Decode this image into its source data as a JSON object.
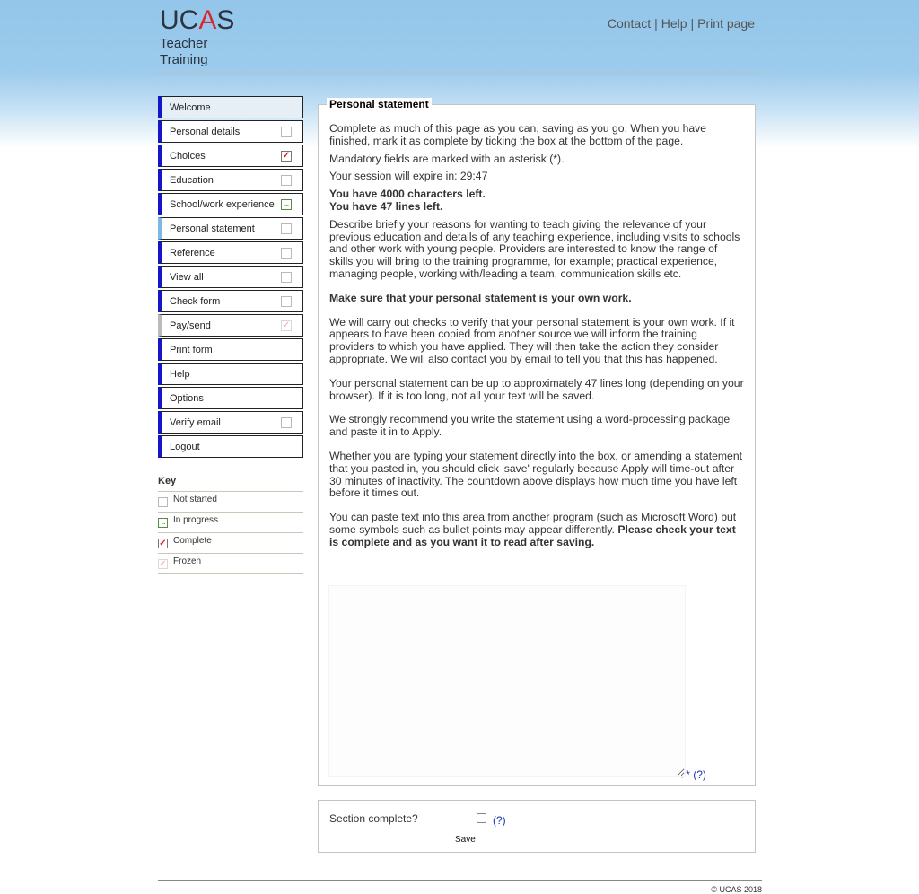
{
  "header": {
    "logo_main_left": "UC",
    "logo_main_accent": "A",
    "logo_main_right": "S",
    "logo_sub": "Teacher Training",
    "links": [
      "Contact",
      "Help",
      "Print page"
    ],
    "separator": "|"
  },
  "nav": {
    "items": [
      {
        "label": "Welcome",
        "status": "none"
      },
      {
        "label": "Personal details",
        "status": "not-started"
      },
      {
        "label": "Choices",
        "status": "complete"
      },
      {
        "label": "Education",
        "status": "not-started"
      },
      {
        "label": "School/work experience",
        "status": "in-progress"
      },
      {
        "label": "Personal statement",
        "status": "not-started",
        "active": true
      },
      {
        "label": "Reference",
        "status": "not-started"
      },
      {
        "label": "View all",
        "status": "not-started"
      },
      {
        "label": "Check form",
        "status": "not-started"
      },
      {
        "label": "Pay/send",
        "status": "frozen"
      },
      {
        "label": "Print form",
        "status": "none"
      },
      {
        "label": "Help",
        "status": "none"
      },
      {
        "label": "Options",
        "status": "none"
      },
      {
        "label": "Verify email",
        "status": "not-started"
      },
      {
        "label": "Logout",
        "status": "none"
      }
    ]
  },
  "key": {
    "title": "Key",
    "items": [
      {
        "label": "Not started",
        "status": "not-started"
      },
      {
        "label": "In progress",
        "status": "in-progress"
      },
      {
        "label": "Complete",
        "status": "complete"
      },
      {
        "label": "Frozen",
        "status": "frozen"
      }
    ]
  },
  "main": {
    "title": "Personal statement",
    "intro": "Complete as much of this page as you can, saving as you go. When you have finished, mark it as complete by ticking the box at the bottom of the page.",
    "mandatory": "Mandatory fields are marked with an asterisk (*).",
    "session": "Your session will expire in: 29:47",
    "chars_left": "You have 4000 characters left.",
    "lines_left": "You have 47 lines left.",
    "describe": "Describe briefly your reasons for wanting to teach giving the relevance of your previous education and details of any teaching experience, including visits to schools and other work with young people. Providers are interested to know the range of skills you will bring to the training programme, for example; practical experience, managing people, working with/leading a team, communication skills etc.",
    "own_work": "Make sure that your personal statement is your own work.",
    "checks": "We will carry out checks to verify that your personal statement is your own work. If it appears to have been copied from another source we will inform the training providers to which you have applied. They will then take the action they consider appropriate. We will also contact you by email to tell you that this has happened.",
    "length": "Your personal statement can be up to approximately 47 lines long (depending on your browser). If it is too long, not all your text will be saved.",
    "recommend": "We strongly recommend you write the statement using a word-processing package and paste it in to Apply.",
    "timeout": "Whether you are typing your statement directly into the box, or amending a statement that you pasted in, you should click 'save' regularly because Apply will time-out after 30 minutes of inactivity. The countdown above displays how much time you have left before it times out.",
    "paste": "You can paste text into this area from another program (such as Microsoft Word) but some symbols such as bullet points may appear differently. ",
    "paste_bold": "Please check your text is complete and as you want it to read after saving.",
    "textarea_value": "",
    "required_marker": "*",
    "help_link": "(?)"
  },
  "footer_form": {
    "section_complete": "Section complete?",
    "help_link": "(?)",
    "save": "Save"
  },
  "copyright": "© UCAS 2018",
  "colors": {
    "nav_accent": "#1515c9",
    "nav_active_accent": "#7cb8e3",
    "complete_tick": "#d0242a",
    "link": "#1a37b4"
  }
}
